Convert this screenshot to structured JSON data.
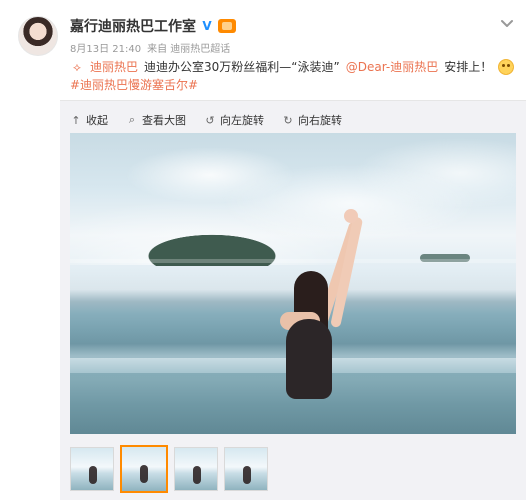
{
  "post": {
    "author": "嘉行迪丽热巴工作室",
    "meta": {
      "date_time": "8月13日 21:40",
      "source": "来自 迪丽热巴超话"
    },
    "lines": [
      {
        "prefix": "迪丽热巴",
        "text": "迪迪办公室30万粉丝福利—“泳装迪”",
        "mention": "@Dear-迪丽热巴",
        "suffix": "安排上！"
      }
    ],
    "hashtag": "#迪丽热巴慢游塞舌尔#"
  },
  "toolbar": {
    "collapse": "收起",
    "view_large": "查看大图",
    "rotate_left": "向左旋转",
    "rotate_right": "向右旋转"
  },
  "icons": {
    "verified": "verified-icon",
    "badge": "badge-icon",
    "chevron": "chevron-down-icon",
    "collapse": "arrow-up-icon",
    "view_large": "search-icon",
    "rotate_left": "rotate-left-icon",
    "rotate_right": "rotate-right-icon",
    "emoji": "smile-emoji-icon"
  },
  "colors": {
    "accent": "#eb7350",
    "selected_thumb_border": "#ff8a00",
    "verified_blue": "#1e8fff"
  },
  "thumbnails": {
    "count": 4,
    "selected_index": 1
  }
}
